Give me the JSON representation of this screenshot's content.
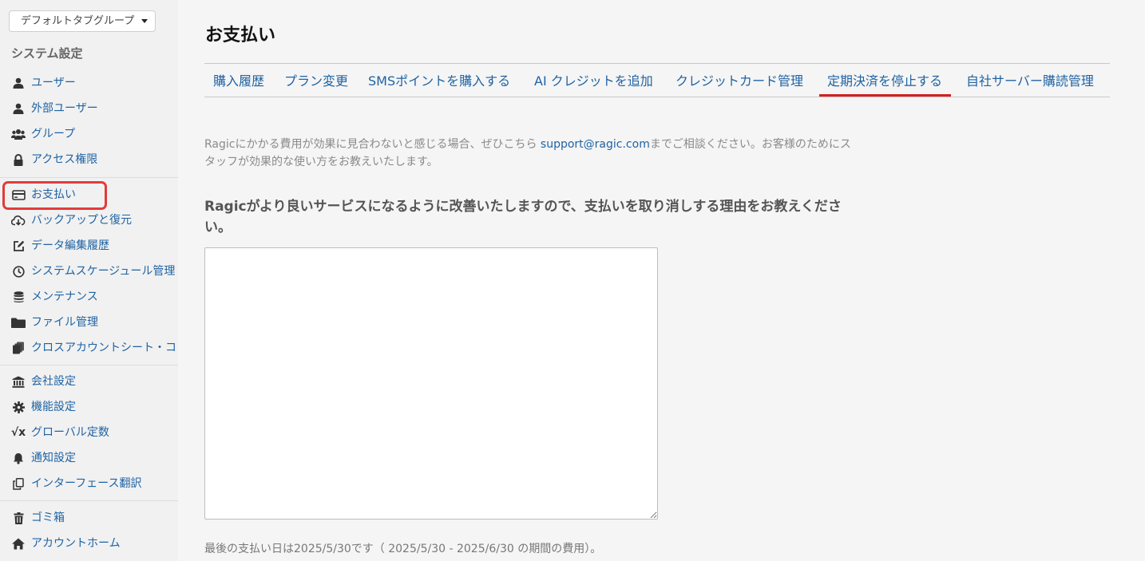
{
  "sidebar": {
    "tab_group_label": "デフォルトタブグループ",
    "section_title": "システム設定",
    "items": [
      {
        "label": "ユーザー",
        "icon": "user-icon"
      },
      {
        "label": "外部ユーザー",
        "icon": "user-icon"
      },
      {
        "label": "グループ",
        "icon": "users-icon"
      },
      {
        "label": "アクセス権限",
        "icon": "lock-icon"
      },
      {
        "label": "お支払い",
        "icon": "credit-card-icon",
        "active": true
      },
      {
        "label": "バックアップと復元",
        "icon": "cloud-download-icon"
      },
      {
        "label": "データ編集履歴",
        "icon": "edit-icon"
      },
      {
        "label": "システムスケージュール管理",
        "icon": "clock-icon"
      },
      {
        "label": "メンテナンス",
        "icon": "database-icon"
      },
      {
        "label": "ファイル管理",
        "icon": "folder-icon"
      },
      {
        "label": "クロスアカウントシート・コ",
        "icon": "stack-icon"
      },
      {
        "label": "会社設定",
        "icon": "bank-icon"
      },
      {
        "label": "機能設定",
        "icon": "gear-icon"
      },
      {
        "label": "グローバル定数",
        "icon": "sqrt-icon"
      },
      {
        "label": "通知設定",
        "icon": "bell-icon"
      },
      {
        "label": "インターフェース翻訳",
        "icon": "copy-icon"
      },
      {
        "label": "ゴミ箱",
        "icon": "trash-icon"
      },
      {
        "label": "アカウントホーム",
        "icon": "home-icon"
      }
    ],
    "active_highlight_color": "#e23b3b"
  },
  "main": {
    "title": "お支払い",
    "tabs": [
      {
        "label": "購入履歴"
      },
      {
        "label": "プラン変更"
      },
      {
        "label": "SMSポイントを購入する"
      },
      {
        "label": "AI クレジットを追加"
      },
      {
        "label": "クレジットカード管理"
      },
      {
        "label": "定期決済を停止する",
        "active": true
      },
      {
        "label": "自社サーバー購読管理"
      }
    ],
    "intro_before": "Ragicにかかる費用が効果に見合わないと感じる場合、ぜひこちら ",
    "support_email": "support@ragic.com",
    "intro_after": "までご相談ください。お客様のためにスタッフが効果的な使い方をお教えいたします。",
    "reason_title": "Ragicがより良いサービスになるように改善いたしますので、支払いを取り消しする理由をお教えください。",
    "reason_value": "",
    "footnote": "最後の支払い日は2025/5/30です（ 2025/5/30 - 2025/6/30 の期間の費用）。",
    "link_color": "#1f63a3",
    "active_tab_color": "#d42020"
  }
}
